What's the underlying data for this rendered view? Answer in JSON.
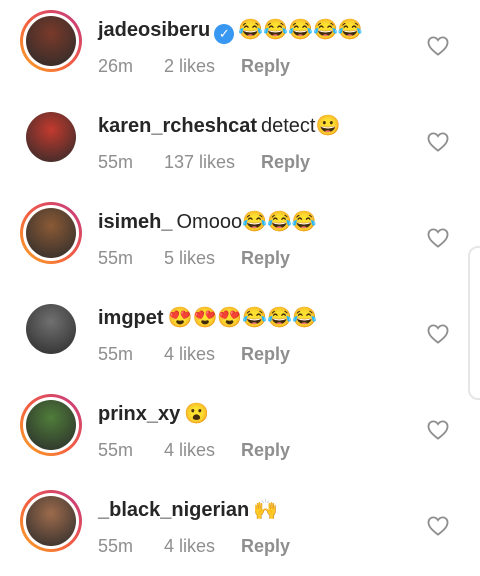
{
  "colors": {
    "accent": "#3897f0",
    "meta": "#8e8e8e",
    "text": "#262626"
  },
  "comments": [
    {
      "username": "jadeosiberu",
      "verified": true,
      "text": "😂😂😂😂😂",
      "time": "26m",
      "likes": "2 likes",
      "reply": "Reply",
      "story_ring": true,
      "avatar_color": "#7a3a2a"
    },
    {
      "username": "karen_rcheshcat",
      "verified": false,
      "text": "detect😀",
      "time": "55m",
      "likes": "137 likes",
      "reply": "Reply",
      "story_ring": false,
      "avatar_color": "#c33a2e"
    },
    {
      "username": "isimeh_",
      "verified": false,
      "text": "Omooo😂😂😂",
      "time": "55m",
      "likes": "5 likes",
      "reply": "Reply",
      "story_ring": true,
      "avatar_color": "#8a5a36"
    },
    {
      "username": "imgpet",
      "verified": false,
      "text": "😍😍😍😂😂😂",
      "time": "55m",
      "likes": "4 likes",
      "reply": "Reply",
      "story_ring": false,
      "avatar_color": "#707070"
    },
    {
      "username": "prinx_xy",
      "verified": false,
      "text": "😮",
      "time": "55m",
      "likes": "4 likes",
      "reply": "Reply",
      "story_ring": true,
      "avatar_color": "#4f7d3a"
    },
    {
      "username": "_black_nigerian",
      "verified": false,
      "text": "🙌",
      "time": "55m",
      "likes": "4 likes",
      "reply": "Reply",
      "story_ring": true,
      "avatar_color": "#9c6b4c"
    }
  ]
}
